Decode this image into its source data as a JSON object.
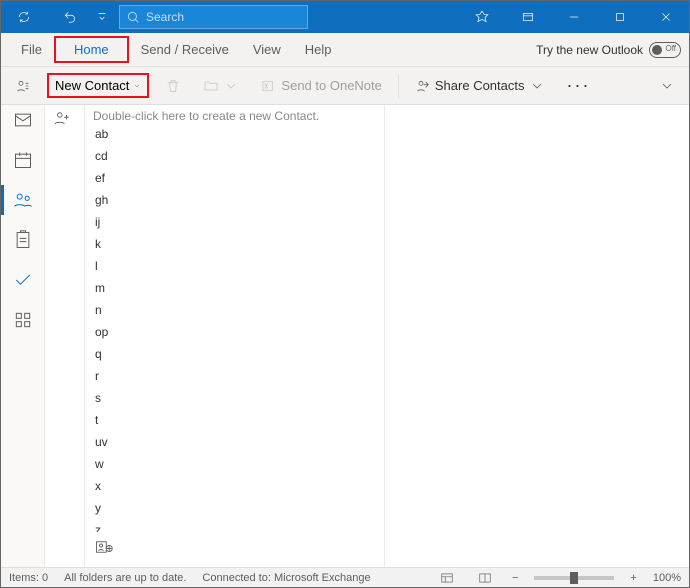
{
  "titlebar": {
    "search_placeholder": "Search"
  },
  "tabs": {
    "file": "File",
    "home": "Home",
    "send_receive": "Send / Receive",
    "view": "View",
    "help": "Help"
  },
  "try_new": {
    "label": "Try the new Outlook",
    "state": "Off"
  },
  "ribbon": {
    "new_contact": "New Contact",
    "send_onenote": "Send to OneNote",
    "share_contacts": "Share Contacts"
  },
  "content": {
    "hint": "Double-click here to create a new Contact.",
    "index": [
      "ab",
      "cd",
      "ef",
      "gh",
      "ij",
      "k",
      "l",
      "m",
      "n",
      "op",
      "q",
      "r",
      "s",
      "t",
      "uv",
      "w",
      "x",
      "y",
      "z"
    ]
  },
  "statusbar": {
    "items_label": "Items: 0",
    "folders_status": "All folders are up to date.",
    "connection": "Connected to: Microsoft Exchange",
    "zoom": "100%"
  }
}
